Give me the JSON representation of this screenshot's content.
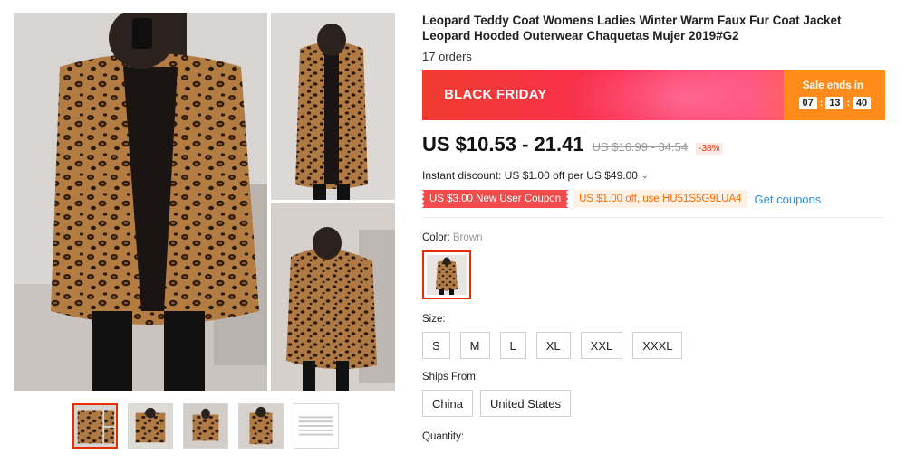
{
  "gallery": {
    "main_image_alt": "leopard coat main image",
    "thumbnails": [
      "thumb-1",
      "thumb-2",
      "thumb-3",
      "thumb-4",
      "thumb-5"
    ]
  },
  "product": {
    "title": "Leopard Teddy Coat Womens Ladies Winter Warm Faux Fur Coat Jacket Leopard Hooded Outerwear Chaquetas Mujer 2019#G2",
    "orders": "17 orders"
  },
  "banner": {
    "label": "BLACK FRIDAY",
    "sale_ends": "Sale ends in",
    "countdown": [
      "07",
      "13",
      "40"
    ],
    "separator": ":"
  },
  "pricing": {
    "price": "US $10.53 - 21.41",
    "original": "US $16.99 - 34.54",
    "discount": "-38%",
    "instant_discount": "Instant discount: US $1.00 off per US $49.00"
  },
  "coupons": {
    "new_user": "US $3.00 New User Coupon",
    "code": "US $1.00 off, use HU51S5G9LUA4",
    "get": "Get coupons"
  },
  "options": {
    "color_label": "Color:",
    "color_value": "Brown",
    "size_label": "Size:",
    "sizes": [
      "S",
      "M",
      "L",
      "XL",
      "XXL",
      "XXXL"
    ],
    "ships_label": "Ships From:",
    "ships": [
      "China",
      "United States"
    ],
    "quantity_label": "Quantity:"
  },
  "colors": {
    "accent": "#e62e04",
    "link": "#2d8fd5",
    "coupon_red": "#f24b4b",
    "coupon_orange": "#ff6a00"
  }
}
